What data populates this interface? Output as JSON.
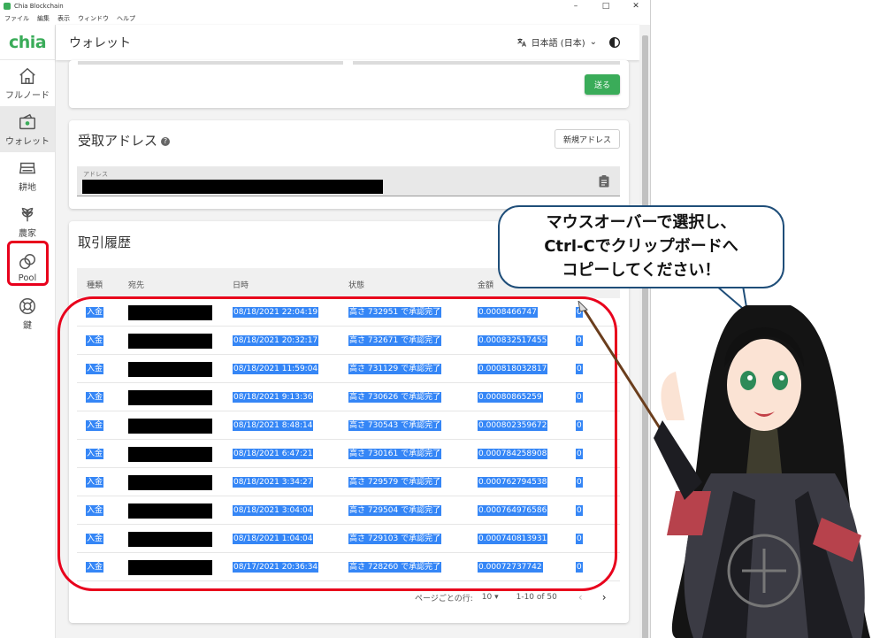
{
  "window": {
    "title": "Chia Blockchain",
    "controls": [
      "–",
      "□",
      "✕"
    ],
    "menu": [
      "ファイル",
      "編集",
      "表示",
      "ウィンドウ",
      "ヘルプ"
    ]
  },
  "sidebar": {
    "logo": "chia",
    "items": [
      {
        "label": "フルノード",
        "icon": "home-icon"
      },
      {
        "label": "ウォレット",
        "icon": "wallet-icon"
      },
      {
        "label": "耕地",
        "icon": "drive-icon"
      },
      {
        "label": "農家",
        "icon": "plant-icon"
      },
      {
        "label": "Pool",
        "icon": "pool-icon"
      },
      {
        "label": "鍵",
        "icon": "lifebuoy-icon"
      }
    ]
  },
  "appbar": {
    "title": "ウォレット",
    "language": "日本語 (日本)"
  },
  "send": {
    "button": "送る"
  },
  "receive": {
    "title": "受取アドレス",
    "new_address_button": "新規アドレス",
    "address_label": "アドレス"
  },
  "history": {
    "title": "取引履歴",
    "columns": [
      "種類",
      "宛先",
      "日時",
      "状態",
      "金額"
    ],
    "rows": [
      {
        "type": "入金",
        "date": "08/18/2021 22:04:19",
        "status": "高さ 732951 で承認完了",
        "amount": "0.0008466747",
        "fee": "0"
      },
      {
        "type": "入金",
        "date": "08/18/2021 20:32:17",
        "status": "高さ 732671 で承認完了",
        "amount": "0.000832517455",
        "fee": "0"
      },
      {
        "type": "入金",
        "date": "08/18/2021 11:59:04",
        "status": "高さ 731129 で承認完了",
        "amount": "0.000818032817",
        "fee": "0"
      },
      {
        "type": "入金",
        "date": "08/18/2021 9:13:36",
        "status": "高さ 730626 で承認完了",
        "amount": "0.00080865259",
        "fee": "0"
      },
      {
        "type": "入金",
        "date": "08/18/2021 8:48:14",
        "status": "高さ 730543 で承認完了",
        "amount": "0.000802359672",
        "fee": "0"
      },
      {
        "type": "入金",
        "date": "08/18/2021 6:47:21",
        "status": "高さ 730161 で承認完了",
        "amount": "0.000784258908",
        "fee": "0"
      },
      {
        "type": "入金",
        "date": "08/18/2021 3:34:27",
        "status": "高さ 729579 で承認完了",
        "amount": "0.000762794538",
        "fee": "0"
      },
      {
        "type": "入金",
        "date": "08/18/2021 3:04:04",
        "status": "高さ 729504 で承認完了",
        "amount": "0.000764976586",
        "fee": "0"
      },
      {
        "type": "入金",
        "date": "08/18/2021 1:04:04",
        "status": "高さ 729103 で承認完了",
        "amount": "0.000740813931",
        "fee": "0"
      },
      {
        "type": "入金",
        "date": "08/17/2021 20:36:34",
        "status": "高さ 728260 で承認完了",
        "amount": "0.00072737742",
        "fee": "0"
      }
    ],
    "pager": {
      "rows_label": "ページごとの行:",
      "rows_value": "10",
      "range": "1-10 of 50"
    }
  },
  "callout": {
    "lines": [
      "マウスオーバーで選択し、",
      "Ctrl-Cでクリップボードへ",
      "コピーしてください！"
    ]
  },
  "colors": {
    "accent": "#3aac59",
    "highlight": "#e8001c",
    "selection": "#3586f6"
  }
}
